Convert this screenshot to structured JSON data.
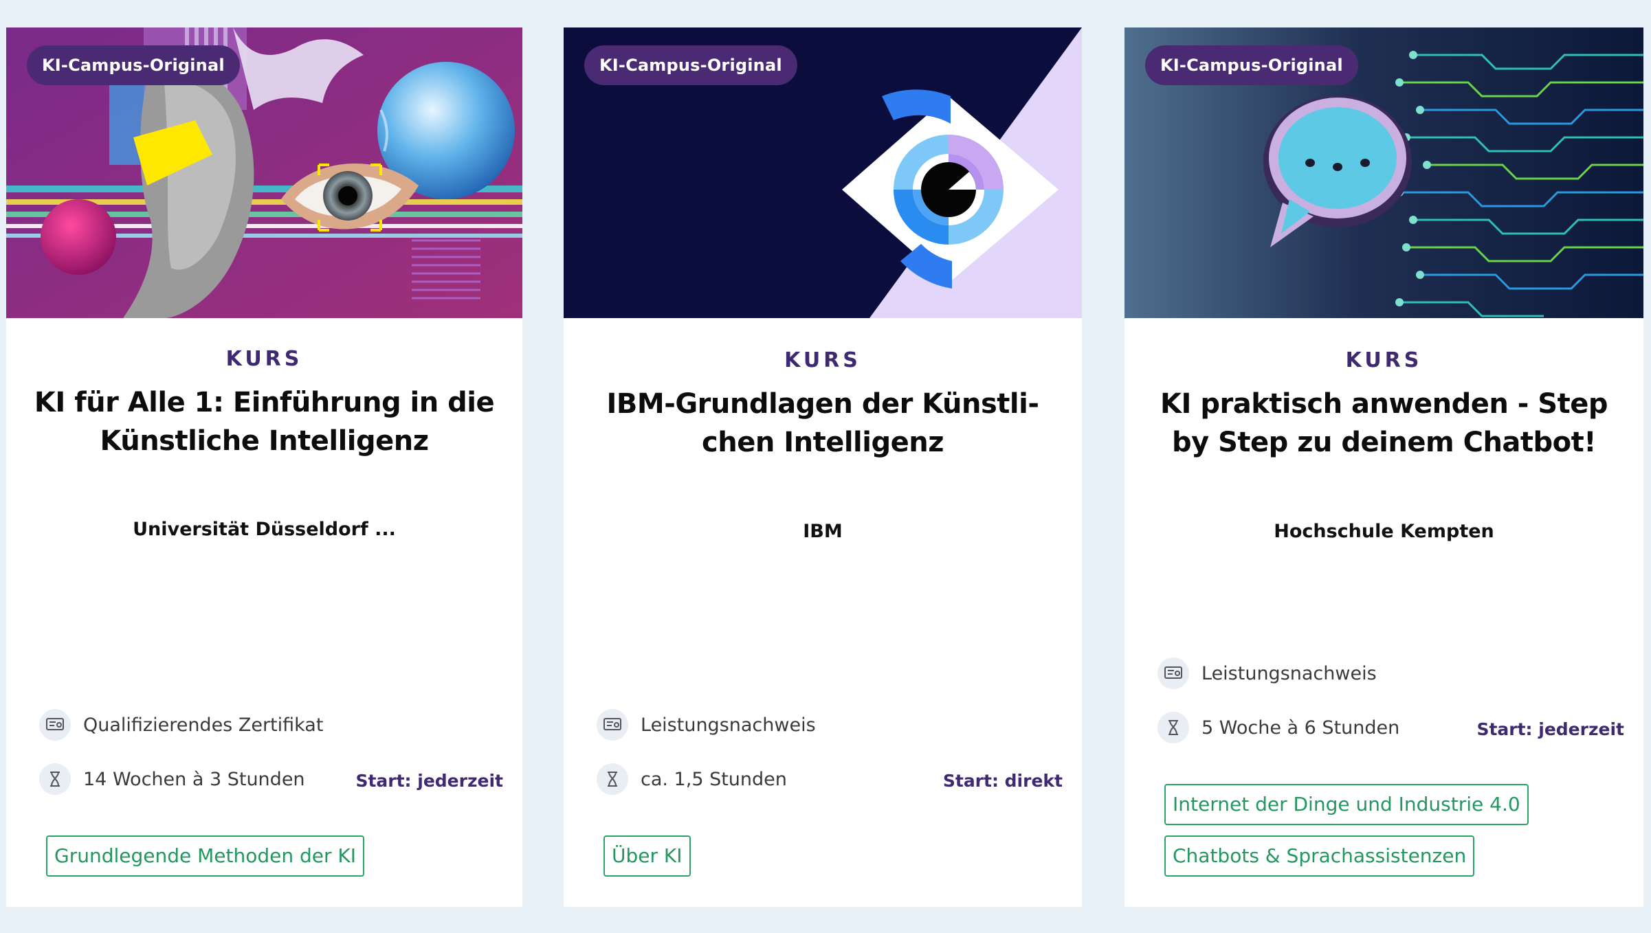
{
  "colors": {
    "page_bg": "#e9f1f8",
    "card_bg": "#ffffff",
    "badge_bg": "#4a2a73",
    "accent_purple": "#3f2a72",
    "tag_green": "#23975f"
  },
  "icons": {
    "certificate": "certificate-icon",
    "duration": "hourglass-icon"
  },
  "cards": [
    {
      "badge": "KI-Campus-Original",
      "kind": "KURS",
      "title_lines": [
        "KI für Alle 1: Einführung in die",
        "Künstliche Intelligenz"
      ],
      "provider": "Universität Düsseldorf ...",
      "certificate": "Qualifizierendes Zertifikat",
      "duration": "14 Wochen à 3 Stunden",
      "start": "Start: jederzeit",
      "tags": [
        "Grundlegende Methoden der KI"
      ]
    },
    {
      "badge": "KI-Campus-Original",
      "kind": "KURS",
      "title_lines": [
        "IBM-Grundlagen der Künstli-",
        "chen Intelligenz"
      ],
      "provider": "IBM",
      "certificate": "Leistungsnachweis",
      "duration": "ca. 1,5 Stunden",
      "start": "Start: direkt",
      "tags": [
        "Über KI"
      ]
    },
    {
      "badge": "KI-Campus-Original",
      "kind": "KURS",
      "title_lines": [
        "KI praktisch anwenden - Step",
        "by Step zu deinem Chatbot!"
      ],
      "provider": "Hochschule Kempten",
      "certificate": "Leistungsnachweis",
      "duration": "5 Woche à 6 Stunden",
      "start": "Start: jederzeit",
      "tags": [
        "Internet der Dinge und Industrie 4.0",
        "Chatbots & Sprachassistenzen"
      ]
    }
  ]
}
